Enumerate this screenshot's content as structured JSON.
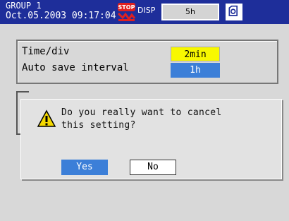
{
  "header": {
    "group": "GROUP 1",
    "datetime": "Oct.05.2003 09:17:04",
    "stop_label": "STOP",
    "disp_label": "DISP",
    "interval": "5h",
    "card_icon": "memory-card-icon"
  },
  "settings": {
    "rows": [
      {
        "label": "Time/div",
        "value": "2min"
      },
      {
        "label": "Auto save interval",
        "value": "1h"
      }
    ]
  },
  "dialog": {
    "icon": "warning-icon",
    "message_line1": "Do you really want to cancel",
    "message_line2": "this setting?",
    "yes_label": "Yes",
    "no_label": "No"
  },
  "colors": {
    "titlebar": "#1e2e9a",
    "highlight_yellow": "#f8f800",
    "selected_blue": "#3c7fd8"
  }
}
